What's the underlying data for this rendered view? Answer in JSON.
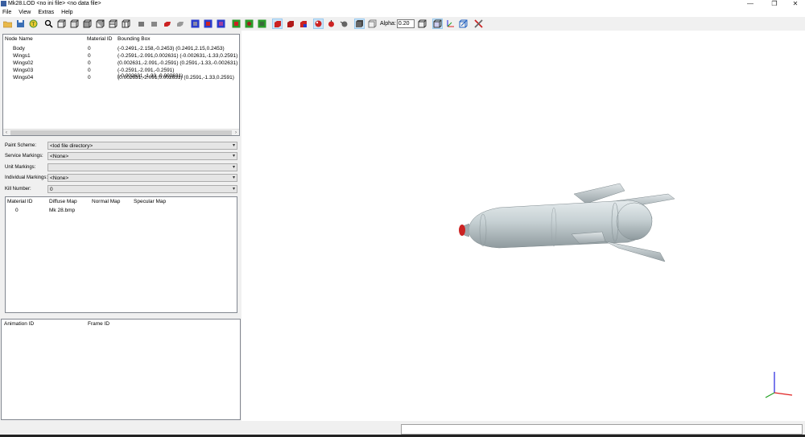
{
  "window": {
    "title": "Mk28.LOD  <no ini file>  <no data file>",
    "minimize_glyph": "—",
    "restore_glyph": "❐",
    "close_glyph": "✕"
  },
  "menu": [
    "File",
    "View",
    "Extras",
    "Help"
  ],
  "toolbar": {
    "alpha_label": "Alpha:",
    "alpha_value": "0.20"
  },
  "node_table": {
    "headers": [
      "Node Name",
      "Material ID",
      "Bounding Box"
    ],
    "rows": [
      {
        "name": "Body",
        "material": "0",
        "bbox": "(-0.2491,-2.158,-0.2453) (0.2491,2.15,0.2453)"
      },
      {
        "name": "Wings1",
        "material": "0",
        "bbox": "(-0.2591,-2.091,0.002631) (-0.002631,-1.33,0.2591)"
      },
      {
        "name": "Wings02",
        "material": "0",
        "bbox": "(0.002631,-2.091,-0.2591) (0.2591,-1.33,-0.002631)"
      },
      {
        "name": "Wings03",
        "material": "0",
        "bbox": "(-0.2591,-2.091,-0.2591) (-0.002631,-1.33,-0.002631)"
      },
      {
        "name": "Wings04",
        "material": "0",
        "bbox": "(0.002631,-2.091,0.002631) (0.2591,-1.33,0.2591)"
      }
    ]
  },
  "fields": {
    "paint_scheme": {
      "label": "Paint Scheme:",
      "value": "<lod file directory>"
    },
    "service_markings": {
      "label": "Service Markings:",
      "value": "<None>"
    },
    "unit_markings": {
      "label": "Unit Markings:",
      "value": ""
    },
    "individual_markings": {
      "label": "Individual Markings:",
      "value": "<None>"
    },
    "kill_number": {
      "label": "Kill Number:",
      "value": "0"
    }
  },
  "material_table": {
    "headers": [
      "Material ID",
      "Diffuse Map",
      "Normal Map",
      "Specular Map"
    ],
    "rows": [
      {
        "id": "0",
        "diffuse": "Mk 28.bmp",
        "normal": "",
        "specular": ""
      }
    ]
  },
  "animation_table": {
    "headers": [
      "Animation ID",
      "Frame ID"
    ]
  },
  "icons": {
    "toolbar": [
      "open-folder-icon",
      "save-icon",
      "texture-icon",
      "zoom-fit-icon",
      "wireframe-icon",
      "shaded-icon",
      "bounding-box-icon",
      "axes-icon",
      "light-icon",
      "color-cube-icon",
      "settings-icon"
    ]
  },
  "colors": {
    "viewport_bg": "#ffffff",
    "model_body": "#b8c4c8",
    "nose_tip": "#cc2222",
    "axis_x": "#e02020",
    "axis_y": "#20a020",
    "axis_z": "#2020e0"
  }
}
